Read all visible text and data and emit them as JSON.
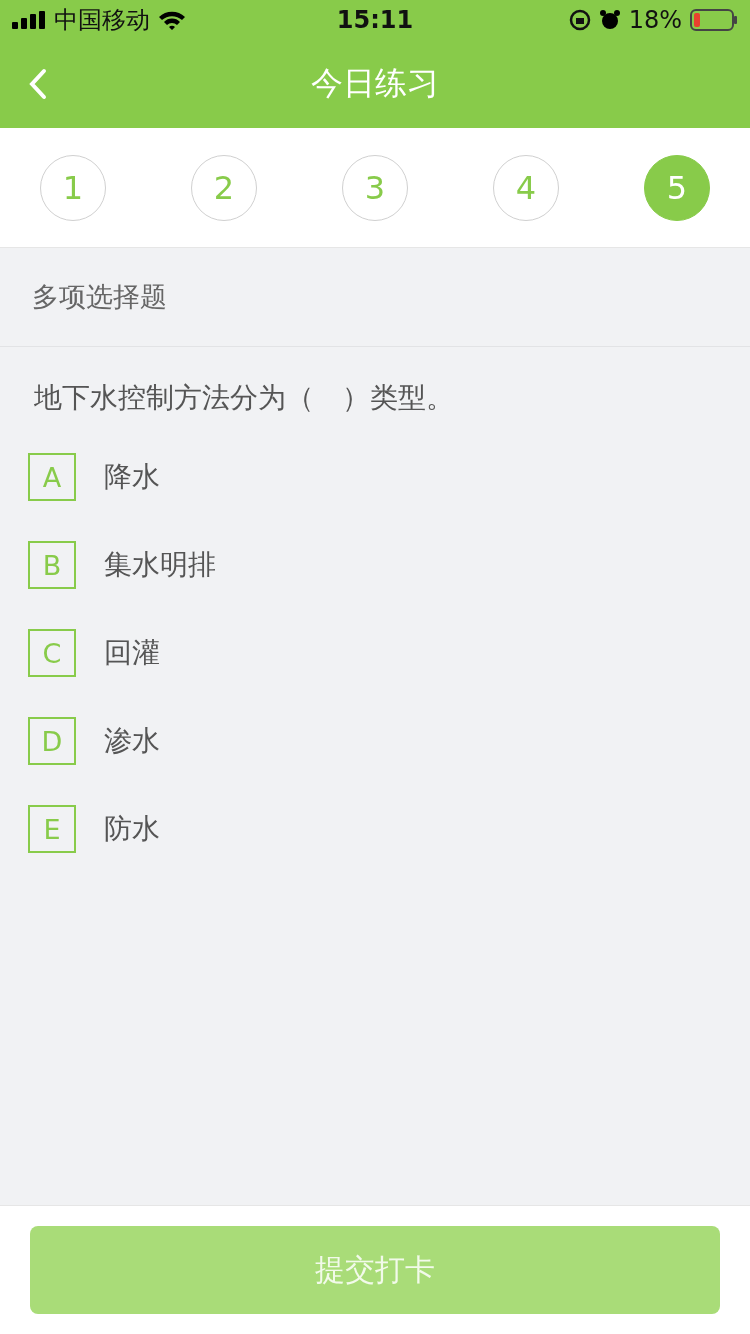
{
  "status_bar": {
    "carrier": "中国移动",
    "time": "15:11",
    "battery": "18%"
  },
  "header": {
    "title": "今日练习"
  },
  "question_tabs": [
    {
      "label": "1",
      "selected": false
    },
    {
      "label": "2",
      "selected": false
    },
    {
      "label": "3",
      "selected": false
    },
    {
      "label": "4",
      "selected": false
    },
    {
      "label": "5",
      "selected": true
    }
  ],
  "section": {
    "title": "多项选择题"
  },
  "question": {
    "text": "地下水控制方法分为（　）类型。"
  },
  "options": [
    {
      "letter": "A",
      "text": "降水",
      "selected": false
    },
    {
      "letter": "B",
      "text": "集水明排",
      "selected": false
    },
    {
      "letter": "C",
      "text": "回灌",
      "selected": false
    },
    {
      "letter": "D",
      "text": "渗水",
      "selected": false
    },
    {
      "letter": "E",
      "text": "防水",
      "selected": false
    }
  ],
  "submit_button": {
    "label": "提交打卡",
    "disabled": true
  }
}
